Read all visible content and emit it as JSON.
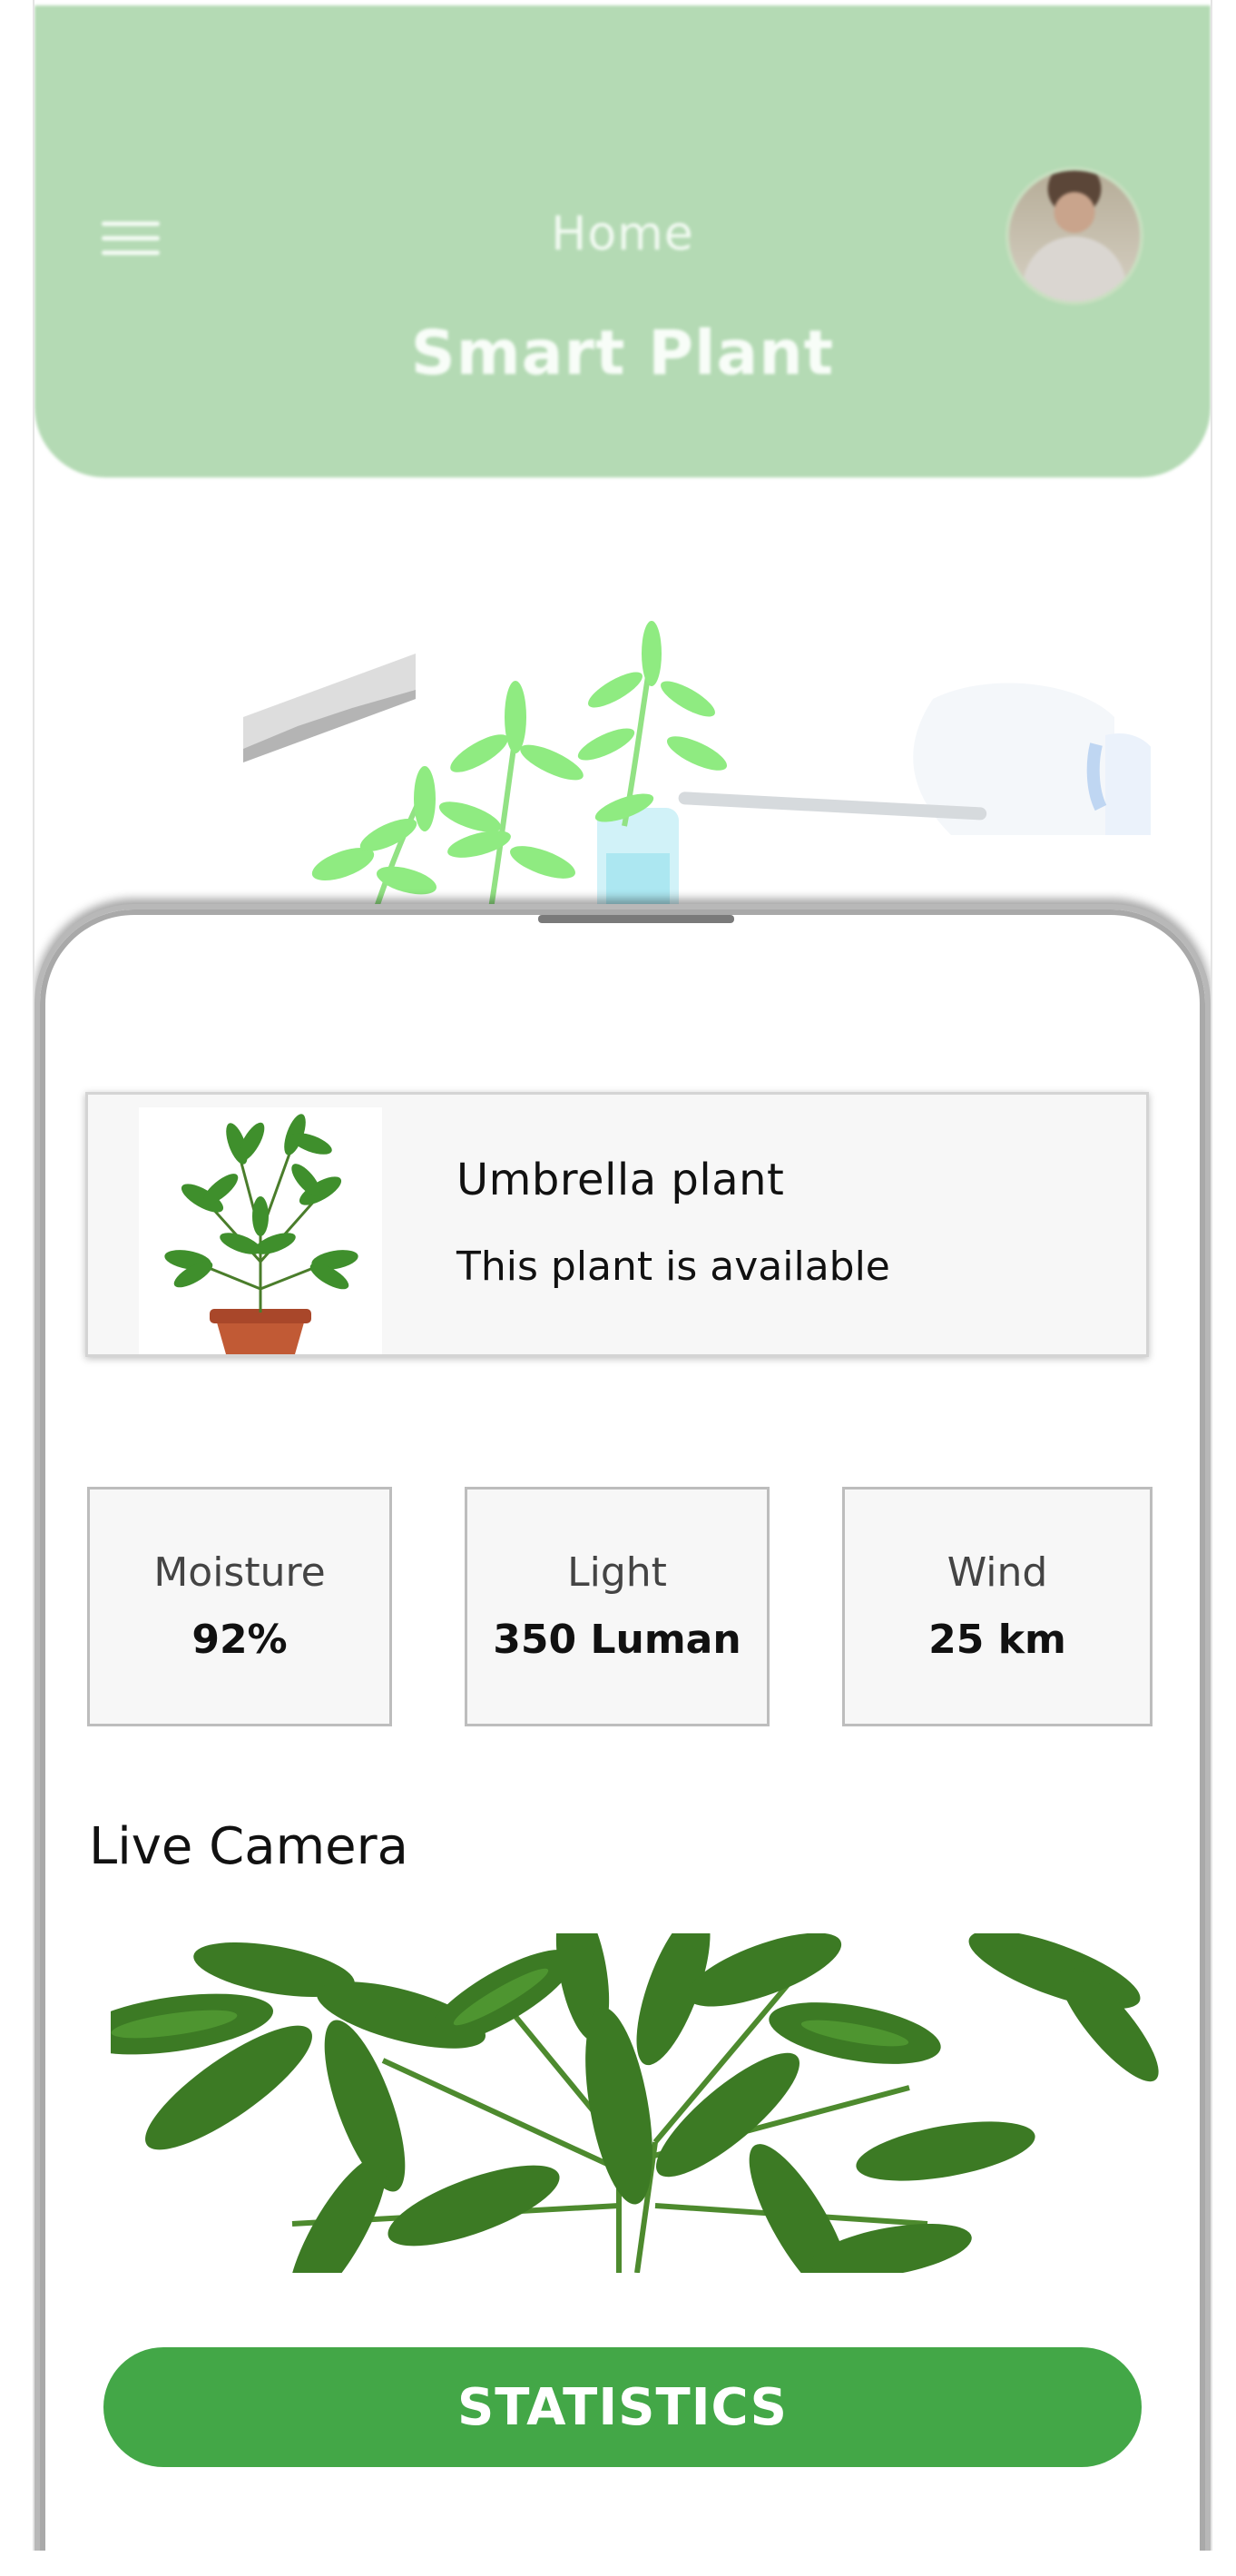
{
  "header": {
    "menu_icon": "hamburger-menu-icon",
    "subtitle": "Home",
    "title": "Smart Plant",
    "avatar_icon": "user-avatar"
  },
  "plant": {
    "name": "Umbrella plant",
    "status": "This plant is available"
  },
  "stats": [
    {
      "label": "Moisture",
      "value": "92%"
    },
    {
      "label": "Light",
      "value": "350 Luman"
    },
    {
      "label": "Wind",
      "value": "25 km"
    }
  ],
  "camera": {
    "title": "Live Camera"
  },
  "actions": {
    "statistics_label": "STATISTICS"
  },
  "colors": {
    "header_bg": "#b4dab4",
    "accent": "#43a747",
    "leaf": "#3f8f2c"
  }
}
